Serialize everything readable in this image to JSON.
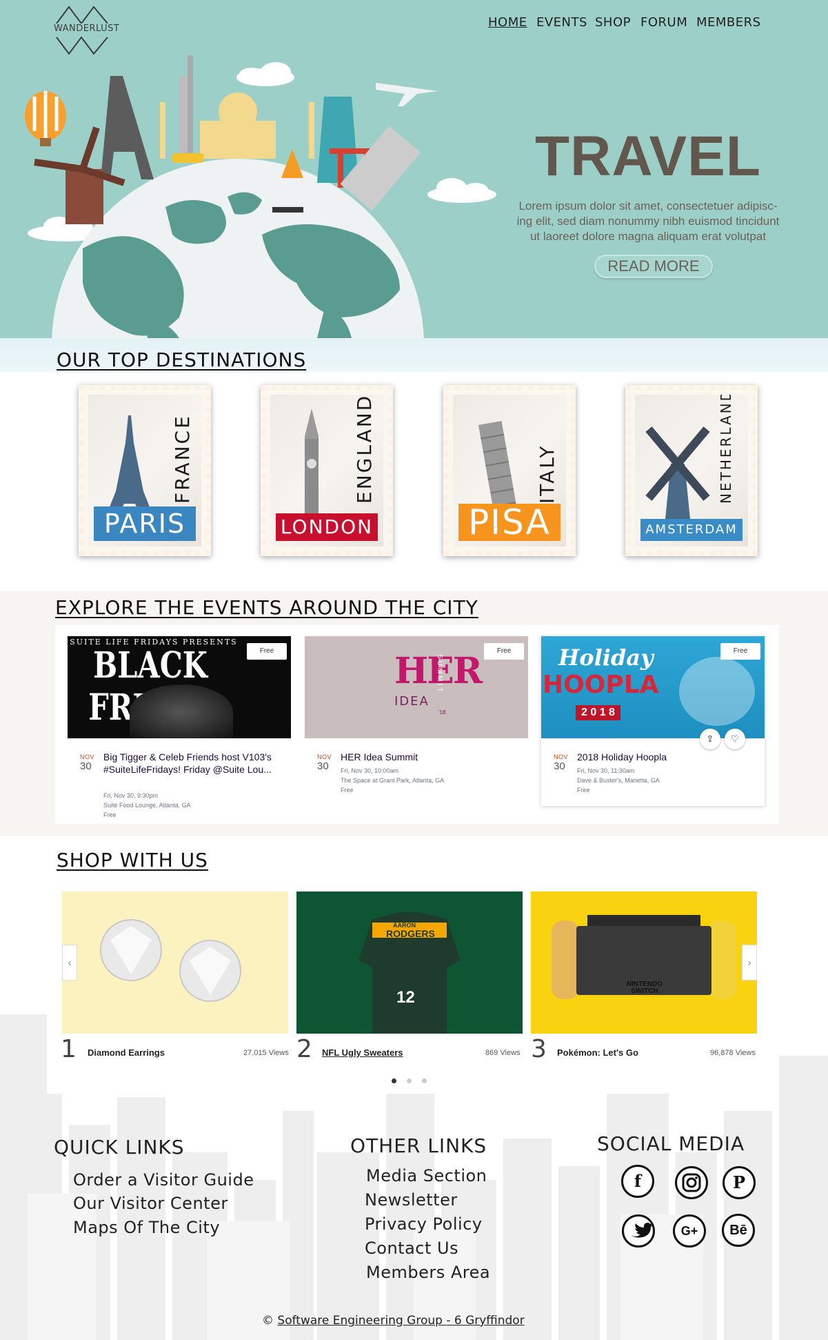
{
  "brand": {
    "logo_text": "WANDERLUST"
  },
  "nav": {
    "items": [
      "HOME",
      "EVENTS",
      "SHOP",
      "FORUM",
      "MEMBERS"
    ],
    "active": "HOME"
  },
  "hero": {
    "title": "TRAVEL",
    "text_lines": [
      "Lorem ipsum dolor sit amet, consectetuer adipisc-",
      "ing elit, sed diam nonummy nibh euismod tincidunt",
      "ut laoreet dolore magna aliquam erat volutpat"
    ],
    "button_label": "READ MORE"
  },
  "destinations": {
    "title": "OUR TOP DESTINATIONS",
    "stamps": [
      {
        "city": "PARIS",
        "country": "FRANCE",
        "color": "#3a86c1"
      },
      {
        "city": "LONDON",
        "country": "ENGLAND",
        "color": "#c8102e"
      },
      {
        "city": "PISA",
        "country": "ITALY",
        "color": "#f7941d"
      },
      {
        "city": "AMSTERDAM",
        "country": "NETHERLAND",
        "color": "#3a8cc7"
      }
    ]
  },
  "events": {
    "title": "EXPLORE THE EVENTS AROUND THE CITY",
    "cards": [
      {
        "badge": "Free",
        "image_caption_top": "SUITE LIFE FRIDAYS PRESENTS",
        "image_caption": "BLACK FRIDAY",
        "month": "NOV",
        "day": "30",
        "title": "Big Tigger & Celeb Friends host V103's #SuiteLifeFridays! Friday @Suite Lou...",
        "date": "Fri, Nov 30, 9:30pm",
        "venue": "Suite Food Lounge, Atlanta, GA",
        "price": "Free"
      },
      {
        "badge": "Free",
        "image_caption": "HER",
        "image_caption_2": "IDEA",
        "image_caption_3": "SUMMIT",
        "image_caption_4": "'18",
        "month": "NOV",
        "day": "30",
        "title": "HER Idea Summit",
        "date": "Fri, Nov 30, 10:00am",
        "venue": "The Space at Grant Park, Atlanta, GA",
        "price": "Free"
      },
      {
        "badge": "Free",
        "image_caption": "Holiday",
        "image_caption_2": "HOOPLA",
        "image_caption_3": "2 0 1 8",
        "month": "NOV",
        "day": "30",
        "title": "2018 Holiday Hoopla",
        "date": "Fri, Nov 30, 11:30am",
        "venue": "Dave & Buster's, Marietta, GA",
        "price": "Free"
      }
    ]
  },
  "shop": {
    "title": "SHOP WITH US",
    "items": [
      {
        "rank": "1",
        "name": "Diamond Earrings",
        "views": "27,015 Views"
      },
      {
        "rank": "2",
        "name": "NFL Ugly Sweaters",
        "views": "869 Views",
        "sweater_top": "AARON",
        "sweater_team": "RODGERS",
        "sweater_num": "12"
      },
      {
        "rank": "3",
        "name": "Pokémon: Let's Go",
        "views": "96,878 Views",
        "console_text": "NINTENDO SWITCH"
      }
    ],
    "prev_icon": "‹",
    "next_icon": "›",
    "dots": 3,
    "active_dot": 0
  },
  "footer": {
    "quick_links": {
      "title": "QUICK LINKS",
      "items": [
        "Order a Visitor Guide",
        "Our Visitor Center",
        "Maps Of The City"
      ]
    },
    "other_links": {
      "title": "OTHER LINKS",
      "items": [
        "Media Section",
        "Newsletter",
        "Privacy Policy",
        "Contact Us",
        "Members Area"
      ]
    },
    "social": {
      "title": "SOCIAL MEDIA",
      "icons": [
        {
          "name": "facebook-icon",
          "glyph": "f"
        },
        {
          "name": "instagram-icon",
          "glyph": ""
        },
        {
          "name": "pinterest-icon",
          "glyph": "P"
        },
        {
          "name": "twitter-icon",
          "glyph": ""
        },
        {
          "name": "google-plus-icon",
          "glyph": "G+"
        },
        {
          "name": "behance-icon",
          "glyph": "Bē"
        }
      ]
    },
    "copyright_symbol": "©",
    "copyright_text": "Software Engineering Group - 6 Gryffindor"
  }
}
